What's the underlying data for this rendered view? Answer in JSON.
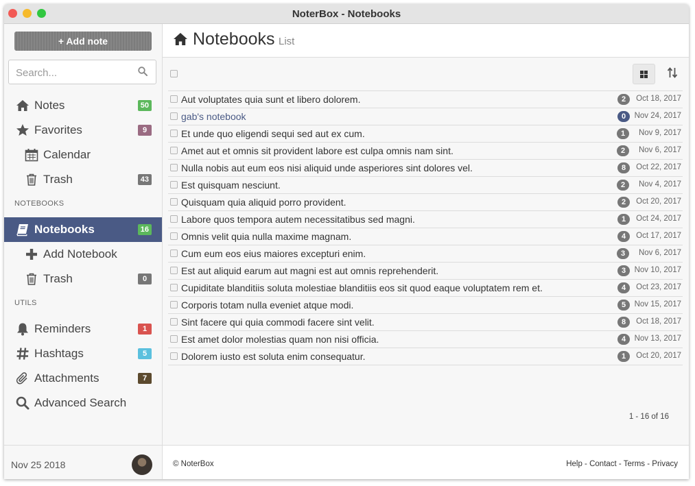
{
  "window": {
    "title": "NoterBox - Notebooks"
  },
  "sidebar": {
    "add_note_label": "+ Add note",
    "search_placeholder": "Search...",
    "items": [
      {
        "label": "Notes",
        "count": "50",
        "icon": "home-icon",
        "color": "#5cb85c"
      },
      {
        "label": "Favorites",
        "count": "9",
        "icon": "star-icon",
        "color": "#9a6b82"
      },
      {
        "label": "Calendar",
        "icon": "calendar-icon"
      },
      {
        "label": "Trash",
        "count": "43",
        "icon": "trash-icon",
        "color": "#777777"
      }
    ],
    "notebooks_header": "NOTEBOOKS",
    "notebook_items": [
      {
        "label": "Notebooks",
        "count": "16",
        "icon": "book-icon",
        "color": "#5cb85c",
        "active": true
      },
      {
        "label": "Add Notebook",
        "icon": "plus-icon"
      },
      {
        "label": "Trash",
        "count": "0",
        "icon": "trash-icon",
        "color": "#777777"
      }
    ],
    "utils_header": "UTILS",
    "util_items": [
      {
        "label": "Reminders",
        "count": "1",
        "icon": "bell-icon",
        "color": "#d9534f"
      },
      {
        "label": "Hashtags",
        "count": "5",
        "icon": "hashtag-icon",
        "color": "#5bc0de"
      },
      {
        "label": "Attachments",
        "count": "7",
        "icon": "paperclip-icon",
        "color": "#5c4a2e"
      },
      {
        "label": "Advanced Search",
        "icon": "search-icon"
      }
    ],
    "footer_date": "Nov 25 2018"
  },
  "main": {
    "title": "Notebooks",
    "subtitle": "List",
    "rows": [
      {
        "title": "Aut voluptates quia sunt et libero dolorem.",
        "count": "2",
        "date": "Oct 18, 2017"
      },
      {
        "title": "gab's notebook",
        "count": "0",
        "date": "Nov 24, 2017",
        "highlight": true
      },
      {
        "title": "Et unde quo eligendi sequi sed aut ex cum.",
        "count": "1",
        "date": "Nov 9, 2017"
      },
      {
        "title": "Amet aut et omnis sit provident labore est culpa omnis nam sint.",
        "count": "2",
        "date": "Nov 6, 2017"
      },
      {
        "title": "Nulla nobis aut eum eos nisi aliquid unde asperiores sint dolores vel.",
        "count": "8",
        "date": "Oct 22, 2017"
      },
      {
        "title": "Est quisquam nesciunt.",
        "count": "2",
        "date": "Nov 4, 2017"
      },
      {
        "title": "Quisquam quia aliquid porro provident.",
        "count": "2",
        "date": "Oct 20, 2017"
      },
      {
        "title": "Labore quos tempora autem necessitatibus sed magni.",
        "count": "1",
        "date": "Oct 24, 2017"
      },
      {
        "title": "Omnis velit quia nulla maxime magnam.",
        "count": "4",
        "date": "Oct 17, 2017"
      },
      {
        "title": "Cum eum eos eius maiores excepturi enim.",
        "count": "3",
        "date": "Nov 6, 2017"
      },
      {
        "title": "Est aut aliquid earum aut magni est aut omnis reprehenderit.",
        "count": "3",
        "date": "Nov 10, 2017"
      },
      {
        "title": "Cupiditate blanditiis soluta molestiae blanditiis eos sit quod eaque voluptatem rem et.",
        "count": "4",
        "date": "Oct 23, 2017"
      },
      {
        "title": "Corporis totam nulla eveniet atque modi.",
        "count": "5",
        "date": "Nov 15, 2017"
      },
      {
        "title": "Sint facere qui quia commodi facere sint velit.",
        "count": "8",
        "date": "Oct 18, 2017"
      },
      {
        "title": "Est amet dolor molestias quam non nisi officia.",
        "count": "4",
        "date": "Nov 13, 2017"
      },
      {
        "title": "Dolorem iusto est soluta enim consequatur.",
        "count": "1",
        "date": "Oct 20, 2017"
      }
    ],
    "pagination": "1 - 16 of 16",
    "footer": {
      "copyright": "© NoterBox",
      "links": [
        "Help",
        "Contact",
        "Terms",
        "Privacy"
      ],
      "separator": " - "
    }
  },
  "colors": {
    "accent": "#4a5a85",
    "badge_gray": "#777777"
  }
}
